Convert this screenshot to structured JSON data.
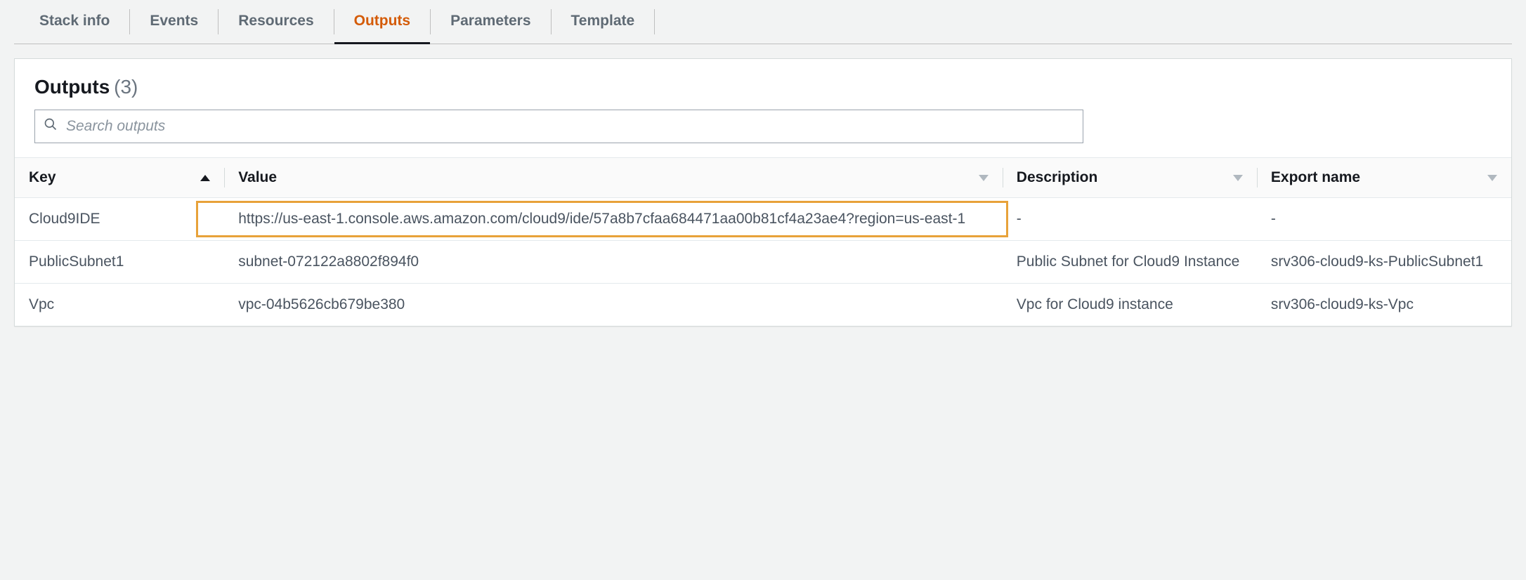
{
  "tabs": [
    {
      "label": "Stack info",
      "active": false
    },
    {
      "label": "Events",
      "active": false
    },
    {
      "label": "Resources",
      "active": false
    },
    {
      "label": "Outputs",
      "active": true
    },
    {
      "label": "Parameters",
      "active": false
    },
    {
      "label": "Template",
      "active": false
    }
  ],
  "panel": {
    "title": "Outputs",
    "count_display": "(3)"
  },
  "search": {
    "placeholder": "Search outputs",
    "value": ""
  },
  "table": {
    "columns": {
      "key": "Key",
      "value": "Value",
      "description": "Description",
      "export_name": "Export name"
    },
    "rows": [
      {
        "key": "Cloud9IDE",
        "value": "https://us-east-1.console.aws.amazon.com/cloud9/ide/57a8b7cfaa684471aa00b81cf4a23ae4?region=us-east-1",
        "description": "-",
        "export_name": "-",
        "highlighted": true
      },
      {
        "key": "PublicSubnet1",
        "value": "subnet-072122a8802f894f0",
        "description": "Public Subnet for Cloud9 Instance",
        "export_name": "srv306-cloud9-ks-PublicSubnet1",
        "highlighted": false
      },
      {
        "key": "Vpc",
        "value": "vpc-04b5626cb679be380",
        "description": "Vpc for Cloud9 instance",
        "export_name": "srv306-cloud9-ks-Vpc",
        "highlighted": false
      }
    ]
  }
}
